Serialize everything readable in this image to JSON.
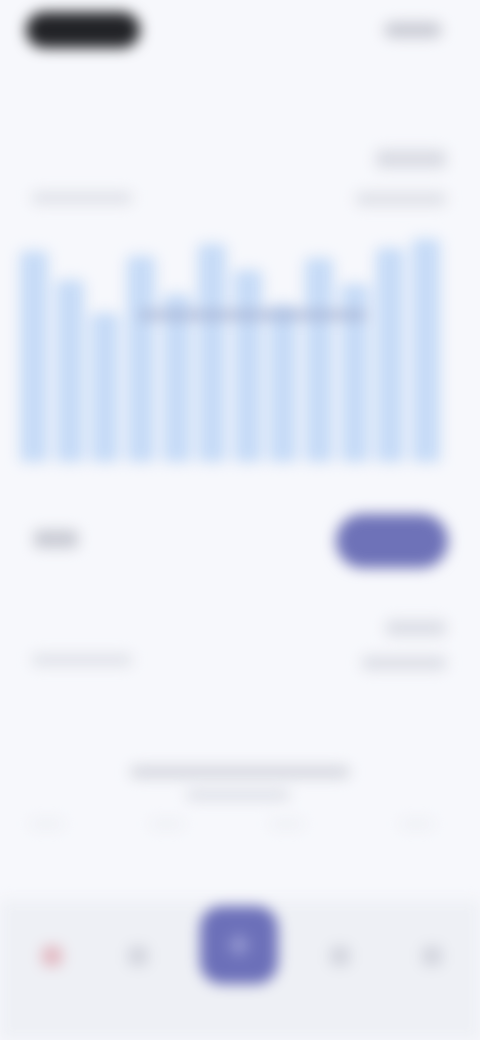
{
  "colors": {
    "background": "#f7f8fc",
    "accent": "#6e72b8",
    "chart_bar": "#c6dbf7",
    "status_pill": "#222327",
    "nav_background": "#eef0f5"
  },
  "status_bar": {
    "left_icon": "status-pill-icon",
    "right_icon": "battery-signal-icon"
  },
  "header": {
    "title": ""
  },
  "section_1": {
    "title": "",
    "meta": "",
    "subtitle": "",
    "sub_right": ""
  },
  "chart_data": {
    "type": "bar",
    "categories": [],
    "values": [
      0.88,
      0.76,
      0.62,
      0.86,
      0.7,
      0.91,
      0.8,
      0.66,
      0.85,
      0.74,
      0.89,
      0.93
    ],
    "title": "",
    "xlabel": "",
    "ylabel": ""
  },
  "row": {
    "label": "",
    "button_label": ""
  },
  "section_2": {
    "title": "",
    "meta": "",
    "subtitle": "",
    "sub_right": ""
  },
  "empty_state": {
    "line1": "",
    "line2": ""
  },
  "bottom_nav": {
    "items": [
      {
        "icon": "home-icon"
      },
      {
        "icon": "chart-icon"
      },
      {
        "icon": "add-icon"
      },
      {
        "icon": "list-icon"
      },
      {
        "icon": "settings-icon"
      }
    ]
  }
}
